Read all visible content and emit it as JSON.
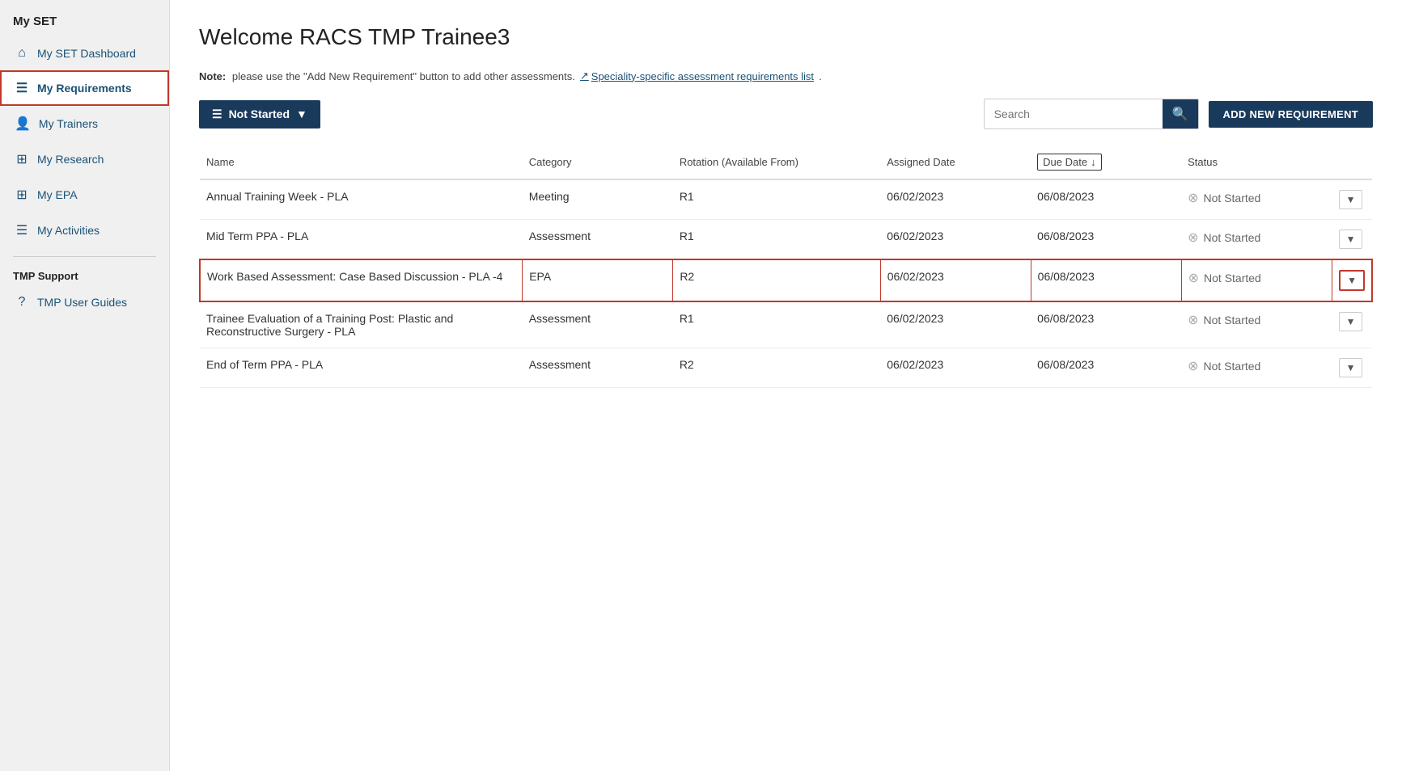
{
  "sidebar": {
    "app_title": "My SET",
    "items": [
      {
        "id": "dashboard",
        "label": "My SET Dashboard",
        "icon": "⌂",
        "active": false
      },
      {
        "id": "requirements",
        "label": "My Requirements",
        "icon": "☰",
        "active": true
      },
      {
        "id": "trainers",
        "label": "My Trainers",
        "icon": "👤",
        "active": false
      },
      {
        "id": "research",
        "label": "My Research",
        "icon": "⊞",
        "active": false
      },
      {
        "id": "epa",
        "label": "My EPA",
        "icon": "⊞",
        "active": false
      },
      {
        "id": "activities",
        "label": "My Activities",
        "icon": "☰",
        "active": false
      }
    ],
    "support_title": "TMP Support",
    "support_items": [
      {
        "id": "user-guides",
        "label": "TMP User Guides",
        "icon": "?",
        "active": false
      }
    ]
  },
  "header": {
    "title": "Welcome RACS TMP Trainee3"
  },
  "note": {
    "text": "Note: please use the \"Add New Requirement\" button to add other assessments.",
    "link_text": "Speciality-specific assessment requirements list",
    "link_icon": "↗"
  },
  "toolbar": {
    "filter_label": "Not Started",
    "filter_icon": "▼",
    "search_placeholder": "Search",
    "add_button_label": "ADD NEW REQUIREMENT"
  },
  "table": {
    "columns": [
      {
        "id": "name",
        "label": "Name"
      },
      {
        "id": "category",
        "label": "Category"
      },
      {
        "id": "rotation",
        "label": "Rotation (Available From)"
      },
      {
        "id": "assigned_date",
        "label": "Assigned Date"
      },
      {
        "id": "due_date",
        "label": "Due Date",
        "sortable": true
      },
      {
        "id": "status",
        "label": "Status"
      },
      {
        "id": "action",
        "label": ""
      }
    ],
    "rows": [
      {
        "id": "row1",
        "name": "Annual Training Week - PLA",
        "category": "Meeting",
        "rotation": "R1",
        "assigned_date": "06/02/2023",
        "due_date": "06/08/2023",
        "status": "Not Started",
        "highlighted": false
      },
      {
        "id": "row2",
        "name": "Mid Term PPA - PLA",
        "category": "Assessment",
        "rotation": "R1",
        "assigned_date": "06/02/2023",
        "due_date": "06/08/2023",
        "status": "Not Started",
        "highlighted": false
      },
      {
        "id": "row3",
        "name": "Work Based Assessment: Case Based Discussion - PLA -4",
        "category": "EPA",
        "rotation": "R2",
        "assigned_date": "06/02/2023",
        "due_date": "06/08/2023",
        "status": "Not Started",
        "highlighted": true
      },
      {
        "id": "row4",
        "name": "Trainee Evaluation of a Training Post: Plastic and Reconstructive Surgery - PLA",
        "category": "Assessment",
        "rotation": "R1",
        "assigned_date": "06/02/2023",
        "due_date": "06/08/2023",
        "status": "Not Started",
        "highlighted": false
      },
      {
        "id": "row5",
        "name": "End of Term PPA - PLA",
        "category": "Assessment",
        "rotation": "R2",
        "assigned_date": "06/02/2023",
        "due_date": "06/08/2023",
        "status": "Not Started",
        "highlighted": false
      }
    ]
  }
}
